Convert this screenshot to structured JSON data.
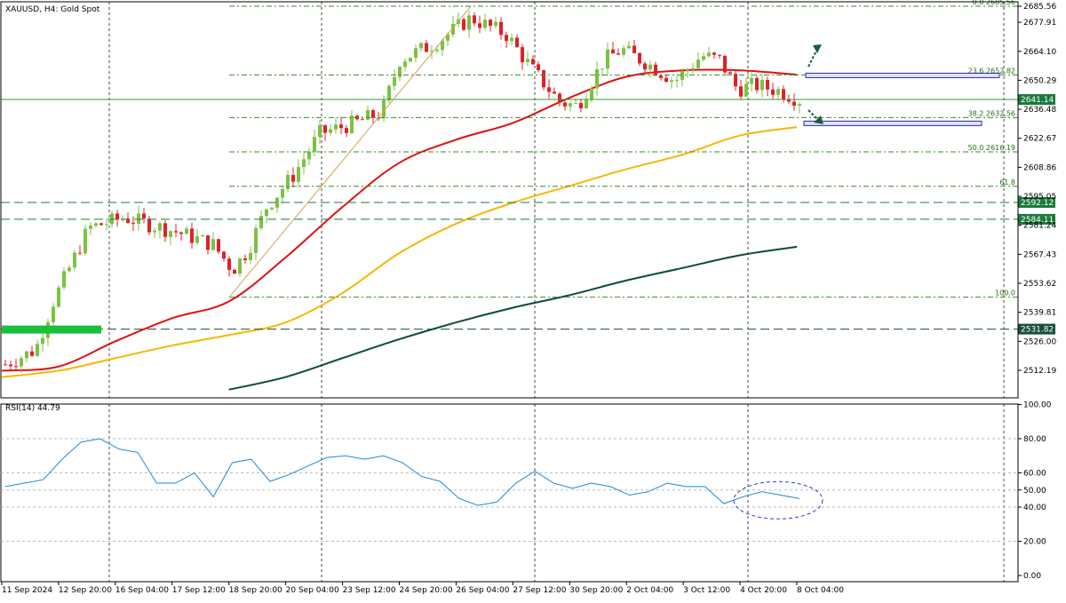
{
  "chart_data": [
    {
      "type": "candlestick",
      "title": "XAUUSD, H4:  Gold Spot",
      "x_tick_labels": [
        "11 Sep 2024",
        "12 Sep 20:00",
        "16 Sep 04:00",
        "17 Sep 12:00",
        "18 Sep 20:00",
        "20 Sep 04:00",
        "23 Sep 12:00",
        "24 Sep 20:00",
        "26 Sep 04:00",
        "27 Sep 12:00",
        "30 Sep 20:00",
        "2 Oct 04:00",
        "3 Oct 12:00",
        "4 Oct 20:00",
        "8 Oct 04:00"
      ],
      "y_tick_labels": [
        "2685.56",
        "2677.91",
        "2664.10",
        "2650.29",
        "2636.48",
        "2622.67",
        "2608.86",
        "2595.05",
        "2581.24",
        "2567.43",
        "2553.62",
        "2539.81",
        "2526.00",
        "2512.19"
      ],
      "ylim": [
        2505,
        2690
      ],
      "last_price": "2641.14",
      "price_levels": [
        {
          "label": "2592.12",
          "price": 2592.12,
          "color": "#1a7a3c"
        },
        {
          "label": "2584.11",
          "price": 2584.11,
          "color": "#1a7a3c"
        },
        {
          "label": "2531.82",
          "price": 2531.82,
          "color": "#1a4f3a"
        }
      ],
      "fibonacci": [
        {
          "label": "0.0 2685.56",
          "price": 2685.56
        },
        {
          "label": "23.6 2652.82",
          "price": 2652.82
        },
        {
          "label": "38.2 2632.56",
          "price": 2632.56
        },
        {
          "label": "50.0 2616.19",
          "price": 2616.19
        },
        {
          "label": "61.8",
          "price": 2599.8
        },
        {
          "label": "100.0",
          "price": 2547.0
        }
      ],
      "series": [
        {
          "name": "",
          "color": "#e01010",
          "x": [
            "11 Sep 2024",
            "12 Sep 20:00",
            "16 Sep 04:00",
            "17 Sep 12:00",
            "18 Sep 20:00",
            "20 Sep 04:00",
            "23 Sep 12:00",
            "24 Sep 20:00",
            "26 Sep 04:00",
            "27 Sep 12:00",
            "30 Sep 20:00",
            "2 Oct 04:00",
            "3 Oct 12:00",
            "4 Oct 20:00",
            "8 Oct 04:00"
          ],
          "values": [
            2512,
            2514,
            2526,
            2537,
            2545,
            2566,
            2590,
            2611,
            2622,
            2630,
            2642,
            2652,
            2655,
            2655,
            2653
          ]
        },
        {
          "name": "",
          "color": "#f5b800",
          "x": [
            "11 Sep 2024",
            "12 Sep 20:00",
            "16 Sep 04:00",
            "17 Sep 12:00",
            "18 Sep 20:00",
            "20 Sep 04:00",
            "23 Sep 12:00",
            "24 Sep 20:00",
            "26 Sep 04:00",
            "27 Sep 12:00",
            "30 Sep 20:00",
            "2 Oct 04:00",
            "3 Oct 12:00",
            "4 Oct 20:00",
            "8 Oct 04:00"
          ],
          "values": [
            2509,
            2512,
            2518,
            2524,
            2529,
            2535,
            2549,
            2568,
            2582,
            2592,
            2600,
            2608,
            2615,
            2624,
            2628
          ]
        },
        {
          "name": "",
          "color": "#0e4a3a",
          "x": [
            "18 Sep 20:00",
            "20 Sep 04:00",
            "23 Sep 12:00",
            "24 Sep 20:00",
            "26 Sep 04:00",
            "27 Sep 12:00",
            "30 Sep 20:00",
            "2 Oct 04:00",
            "3 Oct 12:00",
            "4 Oct 20:00",
            "8 Oct 04:00"
          ],
          "values": [
            2503,
            2509,
            2518,
            2527,
            2535,
            2542,
            2548,
            2555,
            2561,
            2567,
            2571
          ]
        }
      ],
      "grid": true
    },
    {
      "type": "line",
      "title": "RSI(14) 44.79",
      "y_tick_labels": [
        "100.00",
        "80.00",
        "60.00",
        "50.00",
        "40.00",
        "20.00",
        "0.00"
      ],
      "ylim": [
        0,
        100
      ],
      "series": [
        {
          "name": "",
          "color": "#1e88d8",
          "values": [
            52,
            54,
            56,
            68,
            78,
            80,
            74,
            72,
            54,
            54,
            60,
            46,
            66,
            68,
            55,
            59,
            64,
            69,
            70,
            68,
            70,
            66,
            58,
            55,
            45,
            41,
            43,
            54,
            61,
            54,
            51,
            54,
            52,
            47,
            49,
            54,
            52,
            52,
            42,
            46,
            49,
            47,
            45
          ]
        }
      ]
    }
  ]
}
